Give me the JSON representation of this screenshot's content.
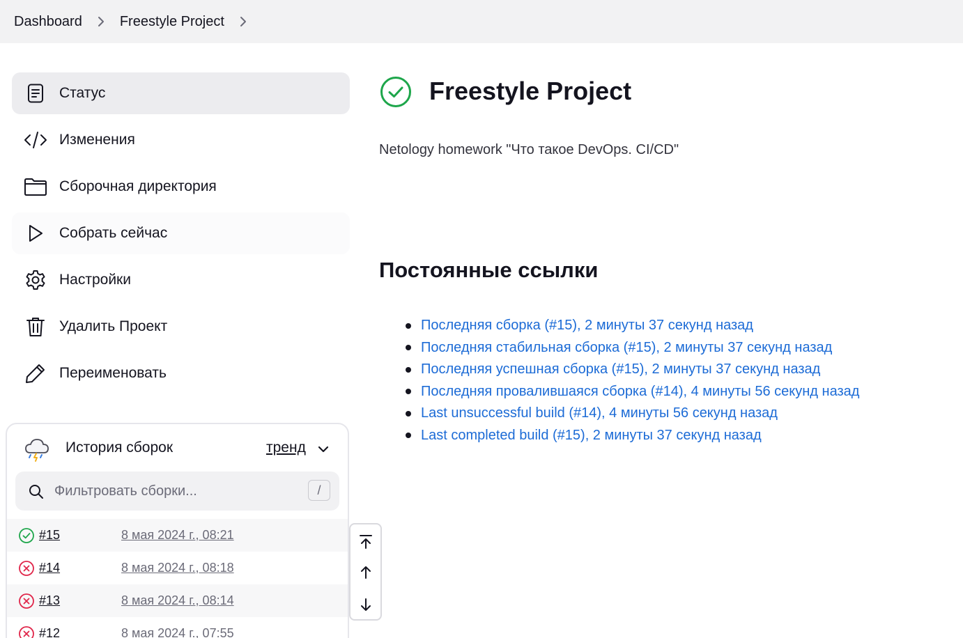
{
  "breadcrumb": {
    "items": [
      "Dashboard",
      "Freestyle Project"
    ]
  },
  "sidebar": {
    "tasks": [
      {
        "label": "Статус",
        "icon": "document-icon"
      },
      {
        "label": "Изменения",
        "icon": "code-icon"
      },
      {
        "label": "Сборочная директория",
        "icon": "folder-icon"
      },
      {
        "label": "Собрать сейчас",
        "icon": "play-icon"
      },
      {
        "label": "Настройки",
        "icon": "gear-icon"
      },
      {
        "label": "Удалить Проект",
        "icon": "trash-icon"
      },
      {
        "label": "Переименовать",
        "icon": "pencil-icon"
      }
    ]
  },
  "build_history": {
    "title": "История сборок",
    "trend_label": "тренд",
    "filter_placeholder": "Фильтровать сборки...",
    "filter_shortcut": "/",
    "builds": [
      {
        "number": "#15",
        "date": "8 мая 2024 г., 08:21",
        "status": "success"
      },
      {
        "number": "#14",
        "date": "8 мая 2024 г., 08:18",
        "status": "failed"
      },
      {
        "number": "#13",
        "date": "8 мая 2024 г., 08:14",
        "status": "failed"
      },
      {
        "number": "#12",
        "date": "8 мая 2024 г., 07:55",
        "status": "failed"
      }
    ]
  },
  "main": {
    "title": "Freestyle Project",
    "description": "Netology homework \"Что такое DevOps. CI/CD\"",
    "permalinks_heading": "Постоянные ссылки",
    "permalinks": [
      "Последняя сборка (#15), 2 минуты 37 секунд назад",
      "Последняя стабильная сборка (#15), 2 минуты 37 секунд назад",
      "Последняя успешная сборка (#15), 2 минуты 37 секунд назад",
      "Последняя провалившаяся сборка (#14), 4 минуты 56 секунд назад",
      "Last unsuccessful build (#14), 4 минуты 56 секунд назад",
      "Last completed build (#15), 2 минуты 37 секунд назад"
    ]
  },
  "colors": {
    "success": "#1ea64b",
    "failed": "#e0264a",
    "link": "#1c6bd6",
    "breadcrumb_bg": "#f2f2f3",
    "active_task_bg": "#ececef"
  }
}
